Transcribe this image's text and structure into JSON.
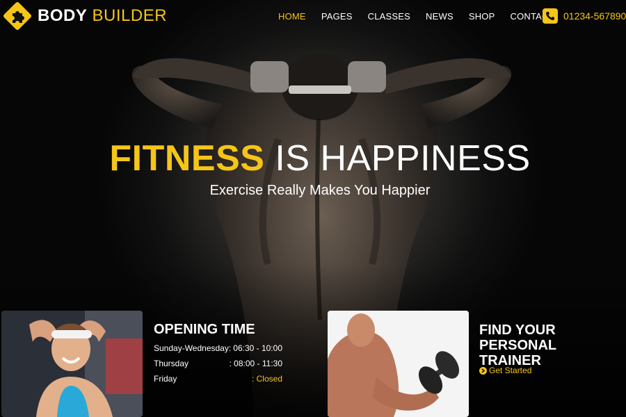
{
  "brand": {
    "name_bold": "BODY",
    "name_light": "BUILDER",
    "icon": "puzzle-icon"
  },
  "nav": {
    "items": [
      {
        "label": "HOME",
        "active": true
      },
      {
        "label": "PAGES"
      },
      {
        "label": "CLASSES"
      },
      {
        "label": "NEWS"
      },
      {
        "label": "SHOP"
      },
      {
        "label": "CONTACT"
      }
    ]
  },
  "contact": {
    "phone": "01234-567890",
    "icon": "phone-icon"
  },
  "hero": {
    "headline_accent": "FITNESS",
    "headline_rest": "IS HAPPINESS",
    "subheadline": "Exercise Really Makes You Happier"
  },
  "opening_time": {
    "title": "OPENING TIME",
    "rows": [
      {
        "day": "Sunday-Wednesday:",
        "time": "06:30 - 10:00"
      },
      {
        "day": "Thursday",
        "time": ": 08:00 - 11:30"
      },
      {
        "day": "Friday",
        "time": ": Closed"
      }
    ]
  },
  "trainer": {
    "title_line1": "FIND YOUR PERSONAL",
    "title_line2": "TRAINER",
    "cta_label": "Get Started",
    "cta_icon": "chevron-circle-right-icon"
  },
  "colors": {
    "accent": "#f5c518",
    "background": "#050505",
    "text": "#ffffff"
  }
}
